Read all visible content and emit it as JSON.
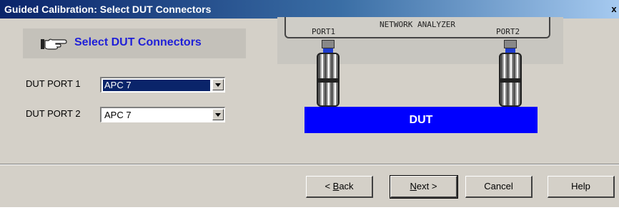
{
  "window": {
    "title": "Guided Calibration: Select DUT Connectors",
    "close_label": "x"
  },
  "banner": {
    "text": "Select DUT Connectors",
    "icon": "pointing-hand-icon"
  },
  "ports": [
    {
      "label": "DUT PORT 1",
      "value": "APC 7"
    },
    {
      "label": "DUT PORT 2",
      "value": "APC 7"
    }
  ],
  "diagram": {
    "analyzer_label": "NETWORK ANALYZER",
    "port1_label": "PORT1",
    "port2_label": "PORT2",
    "dut_label": "DUT",
    "dut_color": "#0000ff",
    "connector_accent": "#1e3cd2"
  },
  "buttons": {
    "back": {
      "prefix": "< ",
      "accel": "B",
      "rest": "ack"
    },
    "next": {
      "accel": "N",
      "rest": "ext >"
    },
    "cancel": "Cancel",
    "help": "Help"
  }
}
